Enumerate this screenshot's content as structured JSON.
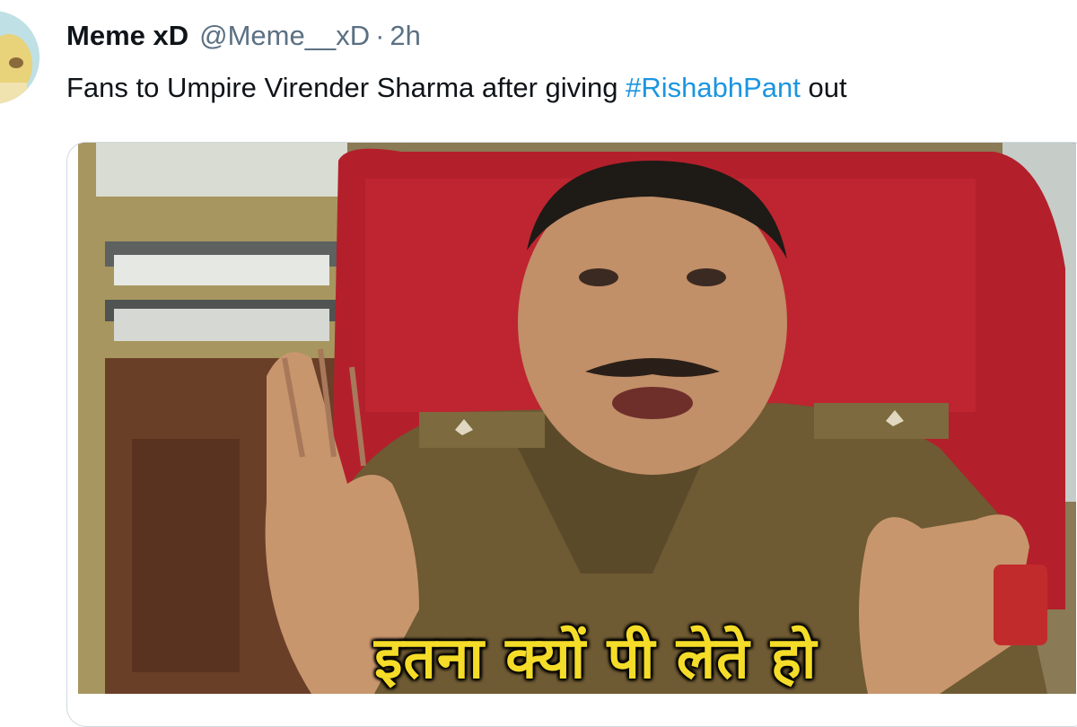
{
  "author": {
    "display_name": "Meme xD",
    "handle": "@Meme__xD",
    "separator": "·",
    "time": "2h",
    "avatar_icon": "avatar-icon"
  },
  "tweet": {
    "text_before": "Fans to Umpire Virender Sharma after giving ",
    "hashtag": "#RishabhPant",
    "text_after": " out"
  },
  "media": {
    "caption": "इतना क्यों पी लेते हो"
  },
  "colors": {
    "text": "#0f1419",
    "secondary": "#5b7083",
    "link": "#1b95e0",
    "card_border": "#cfd9de",
    "caption_yellow": "#f4dc28"
  }
}
